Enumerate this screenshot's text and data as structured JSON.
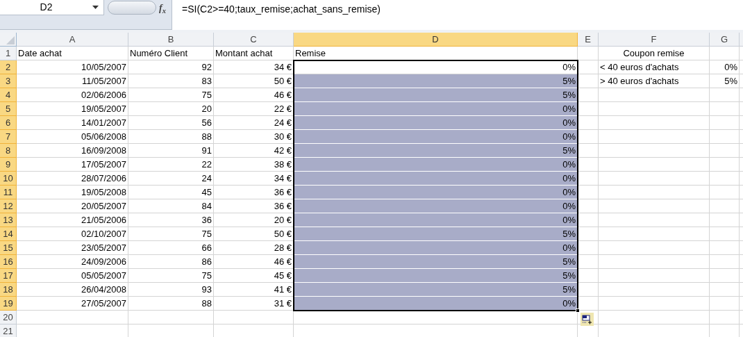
{
  "name_box": "D2",
  "function_button": "f$_{x}$",
  "formula": "=SI(C2>=40;taux_remise;achat_sans_remise)",
  "columns": [
    {
      "letter": "A",
      "selected": false
    },
    {
      "letter": "B",
      "selected": false
    },
    {
      "letter": "C",
      "selected": false
    },
    {
      "letter": "D",
      "selected": true
    },
    {
      "letter": "E",
      "selected": false
    },
    {
      "letter": "F",
      "selected": false
    },
    {
      "letter": "G",
      "selected": false
    }
  ],
  "rows": [
    {
      "number": "1",
      "kind": "header",
      "selected": false,
      "active": false,
      "a": "Date achat",
      "b": "Numéro Client",
      "c": "Montant achat",
      "d": "Remise",
      "f": "Coupon remise"
    },
    {
      "number": "2",
      "kind": "data",
      "selected": true,
      "active": true,
      "a": "10/05/2007",
      "b": "92",
      "c": "34 €",
      "d": "0%",
      "f": "< 40 euros d'achats",
      "g": "0%"
    },
    {
      "number": "3",
      "kind": "data",
      "selected": true,
      "active": false,
      "a": "11/05/2007",
      "b": "83",
      "c": "50 €",
      "d": "5%",
      "f": "> 40 euros d'achats",
      "g": "5%"
    },
    {
      "number": "4",
      "kind": "data",
      "selected": true,
      "active": false,
      "a": "02/06/2006",
      "b": "75",
      "c": "46 €",
      "d": "5%"
    },
    {
      "number": "5",
      "kind": "data",
      "selected": true,
      "active": false,
      "a": "19/05/2007",
      "b": "20",
      "c": "22 €",
      "d": "0%"
    },
    {
      "number": "6",
      "kind": "data",
      "selected": true,
      "active": false,
      "a": "14/01/2007",
      "b": "56",
      "c": "24 €",
      "d": "0%"
    },
    {
      "number": "7",
      "kind": "data",
      "selected": true,
      "active": false,
      "a": "05/06/2008",
      "b": "88",
      "c": "30 €",
      "d": "0%"
    },
    {
      "number": "8",
      "kind": "data",
      "selected": true,
      "active": false,
      "a": "16/09/2008",
      "b": "91",
      "c": "42 €",
      "d": "5%"
    },
    {
      "number": "9",
      "kind": "data",
      "selected": true,
      "active": false,
      "a": "17/05/2007",
      "b": "22",
      "c": "38 €",
      "d": "0%"
    },
    {
      "number": "10",
      "kind": "data",
      "selected": true,
      "active": false,
      "a": "28/07/2006",
      "b": "24",
      "c": "34 €",
      "d": "0%"
    },
    {
      "number": "11",
      "kind": "data",
      "selected": true,
      "active": false,
      "a": "19/05/2008",
      "b": "45",
      "c": "36 €",
      "d": "0%"
    },
    {
      "number": "12",
      "kind": "data",
      "selected": true,
      "active": false,
      "a": "20/05/2007",
      "b": "84",
      "c": "36 €",
      "d": "0%"
    },
    {
      "number": "13",
      "kind": "data",
      "selected": true,
      "active": false,
      "a": "21/05/2006",
      "b": "36",
      "c": "20 €",
      "d": "0%"
    },
    {
      "number": "14",
      "kind": "data",
      "selected": true,
      "active": false,
      "a": "02/10/2007",
      "b": "75",
      "c": "50 €",
      "d": "5%"
    },
    {
      "number": "15",
      "kind": "data",
      "selected": true,
      "active": false,
      "a": "23/05/2007",
      "b": "66",
      "c": "28 €",
      "d": "0%"
    },
    {
      "number": "16",
      "kind": "data",
      "selected": true,
      "active": false,
      "a": "24/09/2006",
      "b": "86",
      "c": "46 €",
      "d": "5%"
    },
    {
      "number": "17",
      "kind": "data",
      "selected": true,
      "active": false,
      "a": "05/05/2007",
      "b": "75",
      "c": "45 €",
      "d": "5%"
    },
    {
      "number": "18",
      "kind": "data",
      "selected": true,
      "active": false,
      "a": "26/04/2008",
      "b": "93",
      "c": "41 €",
      "d": "5%"
    },
    {
      "number": "19",
      "kind": "data",
      "selected": true,
      "active": false,
      "a": "27/05/2007",
      "b": "88",
      "c": "31 €",
      "d": "0%"
    },
    {
      "number": "20",
      "kind": "data",
      "selected": false,
      "active": false
    },
    {
      "number": "21",
      "kind": "data",
      "selected": false,
      "active": false
    }
  ]
}
